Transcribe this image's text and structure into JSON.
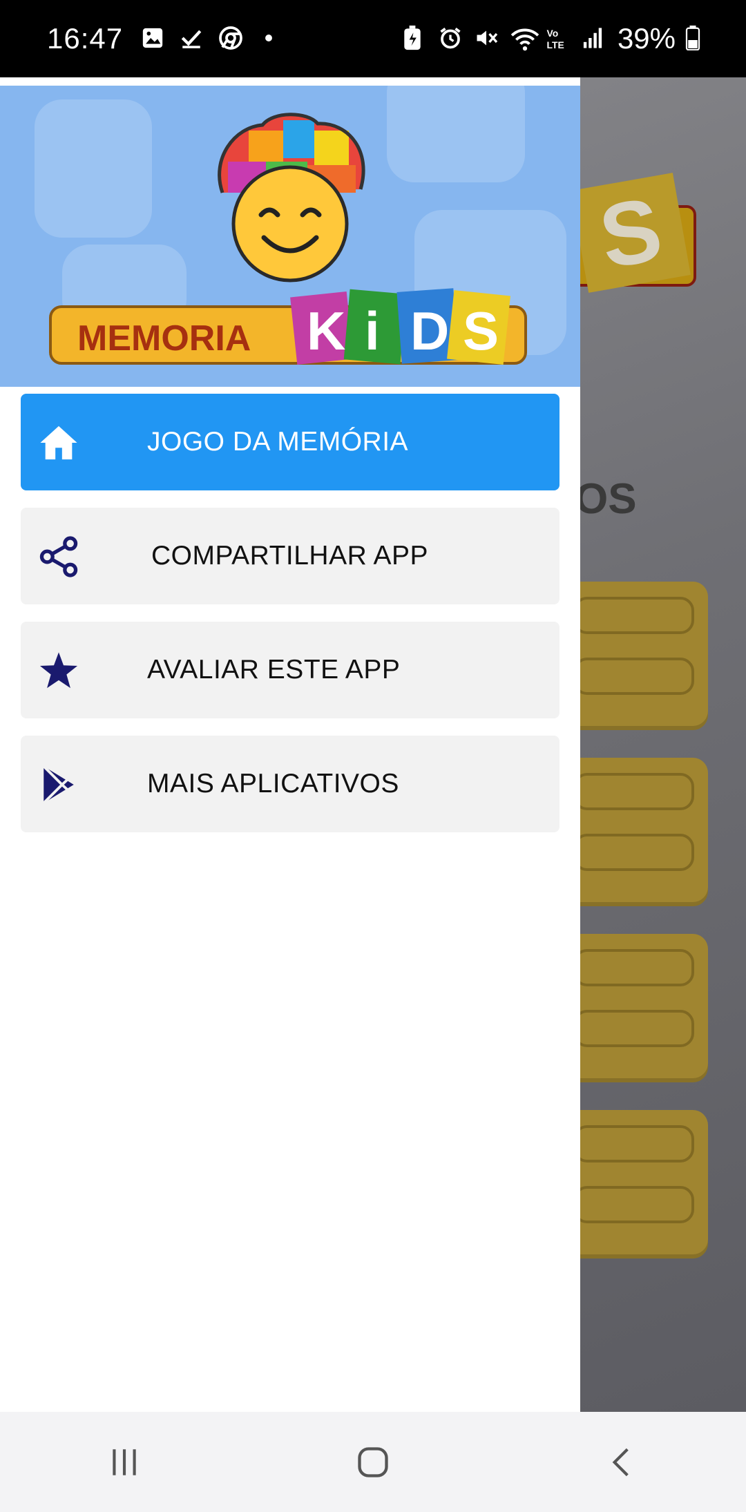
{
  "status_bar": {
    "time": "16:47",
    "left_icons": [
      "gallery-icon",
      "checkmark-icon",
      "chrome-icon",
      "dot-icon"
    ],
    "right_icons": [
      "battery-saver-icon",
      "alarm-icon",
      "mute-icon",
      "wifi-icon",
      "volte-icon",
      "signal-icon"
    ],
    "battery_percent": "39%"
  },
  "drawer": {
    "header": {
      "logo_word_1": "MEMORIA",
      "logo_letters": [
        "K",
        "i",
        "D",
        "S"
      ]
    },
    "menu": [
      {
        "label": "JOGO DA MEMÓRIA",
        "icon": "home-icon",
        "active": true
      },
      {
        "label": "COMPARTILHAR APP",
        "icon": "share-icon",
        "active": false
      },
      {
        "label": "AVALIAR ESTE APP",
        "icon": "star-icon",
        "active": false
      },
      {
        "label": "MAIS APLICATIVOS",
        "icon": "play-store-icon",
        "active": false
      }
    ]
  },
  "background_app": {
    "title_fragment": "OS"
  },
  "nav_bar": {
    "buttons": [
      "recent-apps-icon",
      "home-nav-icon",
      "back-icon"
    ]
  },
  "colors": {
    "accent": "#2196f3",
    "icon_navy": "#1a1a6e",
    "item_bg": "#f2f2f2",
    "header_bg": "#86b6ef"
  }
}
